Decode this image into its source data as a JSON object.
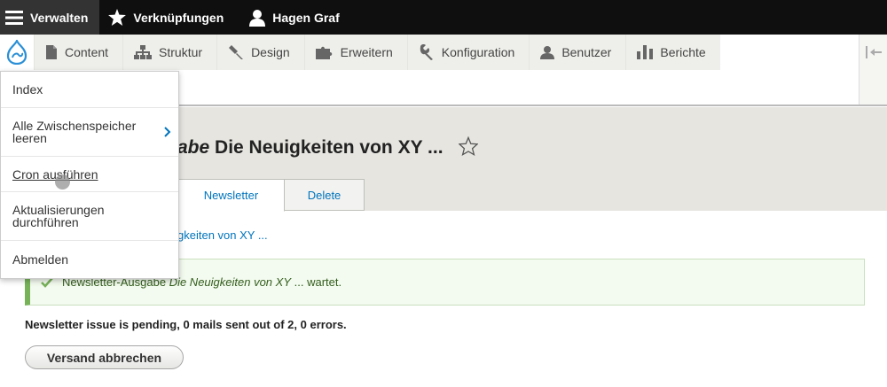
{
  "toolbar": {
    "manage": "Verwalten",
    "shortcuts": "Verknüpfungen",
    "user": "Hagen Graf"
  },
  "tray": {
    "items": [
      "Content",
      "Struktur",
      "Design",
      "Erweitern",
      "Konfiguration",
      "Benutzer",
      "Berichte"
    ]
  },
  "page": {
    "title_prefix": "abe",
    "title_main": "Die Neuigkeiten von XY ...",
    "tabs": [
      "Newsletter",
      "Delete"
    ],
    "link": "gkeiten von XY ...",
    "message_plain": "Newsletter-Ausgabe",
    "message_italic": "Die Neuigkeiten von XY",
    "message_end": "... wartet.",
    "status": "Newsletter issue is pending, 0 mails sent out of 2, 0 errors.",
    "cancel_button": "Versand abbrechen"
  },
  "dropdown": {
    "items": [
      "Index",
      "Alle Zwischenspeicher leeren",
      "Cron ausführen",
      "Aktualisierungen durchführen",
      "Abmelden"
    ]
  },
  "colors": {
    "link": "#0074bd",
    "success_border": "#77b259",
    "toolbar_bg": "#0f0f0f"
  }
}
